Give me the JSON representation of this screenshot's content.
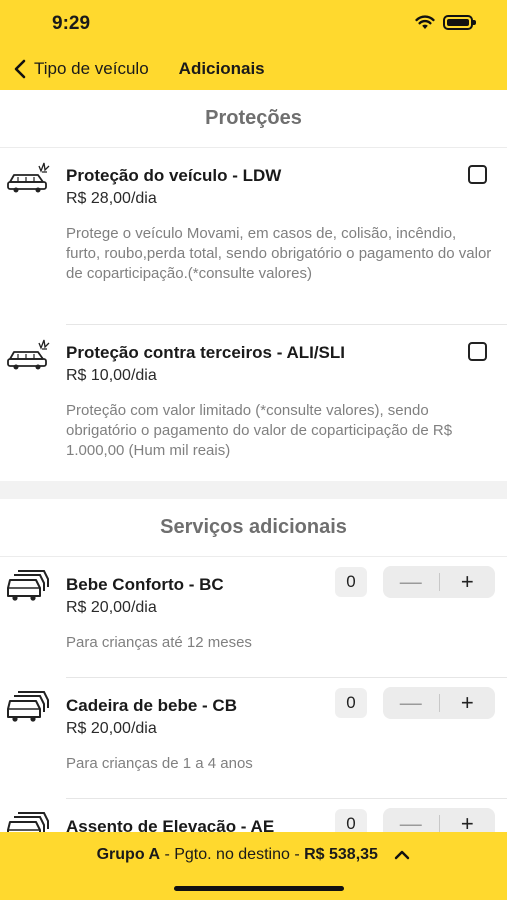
{
  "status_bar": {
    "time": "9:29",
    "icons": [
      "wifi-icon",
      "battery-icon"
    ]
  },
  "nav": {
    "back_label": "Tipo de veículo",
    "title": "Adicionais"
  },
  "protections": {
    "section_title": "Proteções",
    "items": [
      {
        "title": "Proteção do veículo - LDW",
        "price": "R$ 28,00/dia",
        "description": "Protege o veículo Movami, em casos de, colisão, incêndio, furto, roubo,perda total, sendo obrigatório o pagamento do valor de coparticipação.(*consulte valores)",
        "checked": false,
        "icon": "car-crash-icon"
      },
      {
        "title": "Proteção contra terceiros - ALI/SLI",
        "price": "R$ 10,00/dia",
        "description": "Proteção com valor limitado (*consulte valores), sendo obrigatório o pagamento do valor de coparticipação de R$ 1.000,00 (Hum mil reais)",
        "checked": false,
        "icon": "car-crash-icon"
      }
    ]
  },
  "services": {
    "section_title": "Serviços adicionais",
    "items": [
      {
        "title": "Bebe Conforto - BC",
        "price": "R$ 20,00/dia",
        "description": "Para crianças até 12 meses",
        "quantity": "0",
        "icon": "cars-stack-icon"
      },
      {
        "title": "Cadeira de bebe - CB",
        "price": "R$ 20,00/dia",
        "description": "Para crianças de 1 a 4 anos",
        "quantity": "0",
        "icon": "cars-stack-icon"
      },
      {
        "title": "Assento de Elevação - AE",
        "price": "",
        "description": "",
        "quantity": "0",
        "icon": "cars-stack-icon"
      }
    ],
    "minus_symbol": "—",
    "plus_symbol": "+"
  },
  "footer": {
    "group": "Grupo A",
    "separator1": " - ",
    "payment": "Pgto. no destino",
    "separator2": " - ",
    "total": "R$ 538,35",
    "chevron": "chevron-up-icon"
  },
  "colors": {
    "accent": "#ffd92e",
    "section_title": "#6f6f6f",
    "description": "#808080"
  }
}
